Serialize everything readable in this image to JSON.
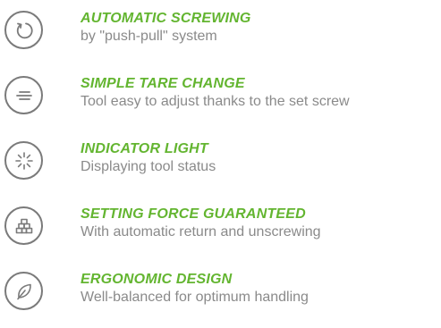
{
  "features": [
    {
      "icon": "rotate-arrow-icon",
      "title": "AUTOMATIC SCREWING",
      "description": "by \"push-pull\" system"
    },
    {
      "icon": "horizontal-lines-icon",
      "title": "SIMPLE TARE CHANGE",
      "description": "Tool easy to adjust thanks to the set screw"
    },
    {
      "icon": "light-burst-icon",
      "title": "INDICATOR LIGHT",
      "description": "Displaying tool status"
    },
    {
      "icon": "stacked-blocks-icon",
      "title": "SETTING FORCE GUARANTEED",
      "description": "With automatic return and unscrewing"
    },
    {
      "icon": "leaf-icon",
      "title": "ERGONOMIC DESIGN",
      "description": "Well-balanced for optimum handling"
    }
  ],
  "colors": {
    "title": "#63b530",
    "description": "#8a8a8a",
    "icon_stroke": "#7a7a7a"
  }
}
